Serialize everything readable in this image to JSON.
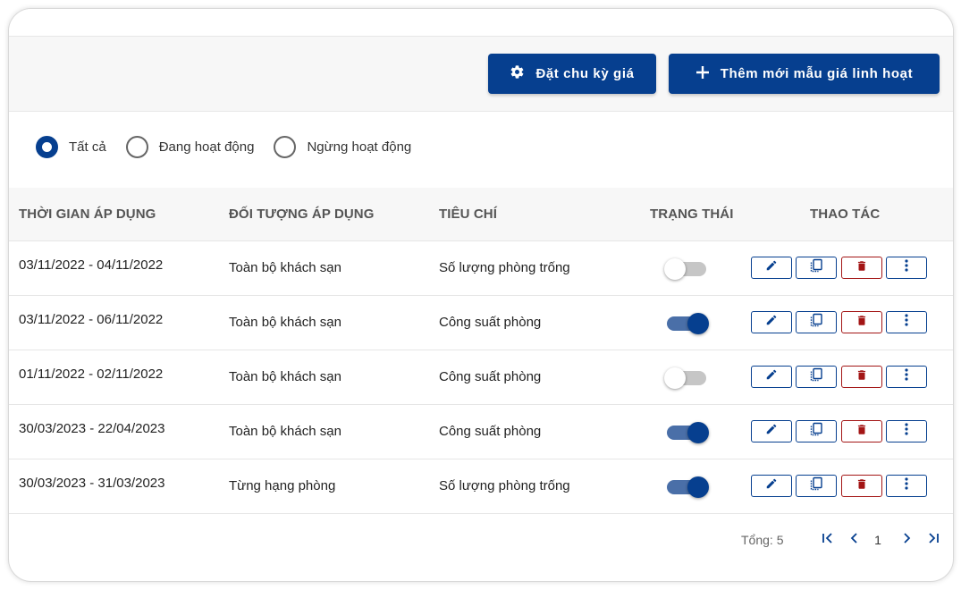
{
  "toolbar": {
    "cycle_button": "Đặt chu kỳ giá",
    "add_button": "Thêm mới mẫu giá linh hoạt"
  },
  "filters": [
    {
      "label": "Tất cả",
      "checked": true
    },
    {
      "label": "Đang hoạt động",
      "checked": false
    },
    {
      "label": "Ngừng hoạt động",
      "checked": false
    }
  ],
  "table": {
    "headers": {
      "time": "THỜI GIAN ÁP DỤNG",
      "object": "ĐỐI TƯỢNG ÁP DỤNG",
      "criteria": "TIÊU CHÍ",
      "status": "TRẠNG THÁI",
      "actions": "THAO TÁC"
    },
    "rows": [
      {
        "time": "03/11/2022 - 04/11/2022",
        "object": "Toàn bộ khách sạn",
        "criteria": "Số lượng phòng trống",
        "active": false
      },
      {
        "time": "03/11/2022 - 06/11/2022",
        "object": "Toàn bộ khách sạn",
        "criteria": "Công suất phòng",
        "active": true
      },
      {
        "time": "01/11/2022 - 02/11/2022",
        "object": "Toàn bộ khách sạn",
        "criteria": "Công suất phòng",
        "active": false
      },
      {
        "time": "30/03/2023 - 22/04/2023",
        "object": "Toàn bộ khách sạn",
        "criteria": "Công suất phòng",
        "active": true
      },
      {
        "time": "30/03/2023 - 31/03/2023",
        "object": "Từng hạng phòng",
        "criteria": "Số lượng phòng trống",
        "active": true
      }
    ]
  },
  "pagination": {
    "total_label": "Tổng: 5",
    "current_page": "1"
  },
  "colors": {
    "primary": "#063f8f",
    "danger": "#a31515",
    "toggle_on_track": "#4a6fa8",
    "toggle_off_track": "#c6c6c6"
  },
  "icons": [
    "gear-icon",
    "plus-icon",
    "edit-icon",
    "copy-icon",
    "trash-icon",
    "more-vertical-icon",
    "first-page-icon",
    "prev-page-icon",
    "next-page-icon",
    "last-page-icon"
  ]
}
